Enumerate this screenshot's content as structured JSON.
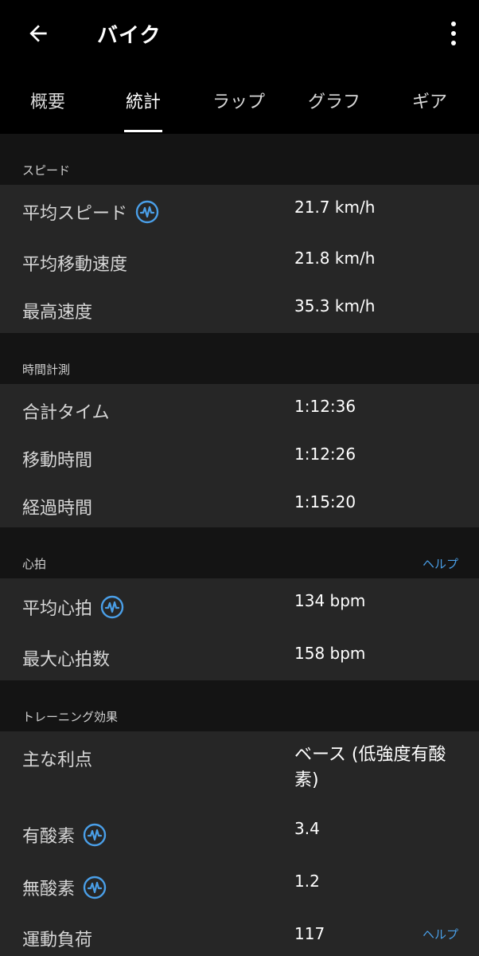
{
  "header": {
    "title": "バイク"
  },
  "tabs": [
    {
      "label": "概要"
    },
    {
      "label": "統計"
    },
    {
      "label": "ラップ"
    },
    {
      "label": "グラフ"
    },
    {
      "label": "ギア"
    }
  ],
  "active_tab_index": 1,
  "sections": {
    "speed": {
      "title": "スピード",
      "rows": [
        {
          "label": "平均スピード",
          "value": "21.7 km/h",
          "icon": "heart-rate-monitor-icon"
        },
        {
          "label": "平均移動速度",
          "value": "21.8 km/h"
        },
        {
          "label": "最高速度",
          "value": "35.3 km/h"
        }
      ]
    },
    "timing": {
      "title": "時間計測",
      "rows": [
        {
          "label": "合計タイム",
          "value": "1:12:36"
        },
        {
          "label": "移動時間",
          "value": "1:12:26"
        },
        {
          "label": "経過時間",
          "value": "1:15:20"
        }
      ]
    },
    "heart_rate": {
      "title": "心拍",
      "help": "ヘルプ",
      "rows": [
        {
          "label": "平均心拍",
          "value": "134 bpm",
          "icon": "heart-rate-monitor-icon"
        },
        {
          "label": "最大心拍数",
          "value": "158 bpm"
        }
      ]
    },
    "training_effect": {
      "title": "トレーニング効果",
      "rows": [
        {
          "label": "主な利点",
          "value": "ベース (低強度有酸素)"
        },
        {
          "label": "有酸素",
          "value": "3.4",
          "icon": "heart-rate-monitor-icon"
        },
        {
          "label": "無酸素",
          "value": "1.2",
          "icon": "heart-rate-monitor-icon"
        },
        {
          "label": "運動負荷",
          "value": "117",
          "help": "ヘルプ"
        }
      ]
    }
  },
  "colors": {
    "accent": "#4a9fe8",
    "background": "#141414",
    "card": "#262626",
    "topbar": "#000000"
  }
}
